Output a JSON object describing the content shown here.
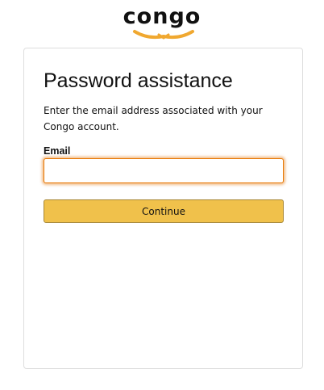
{
  "brand": {
    "name": "congo",
    "accent_color": "#f0a830"
  },
  "form": {
    "title": "Password assistance",
    "description": "Enter the email address associated with your Congo account.",
    "email_label": "Email",
    "email_value": "",
    "email_placeholder": "",
    "continue_label": "Continue",
    "button_color": "#f0c14b",
    "focus_color": "#e77600"
  }
}
